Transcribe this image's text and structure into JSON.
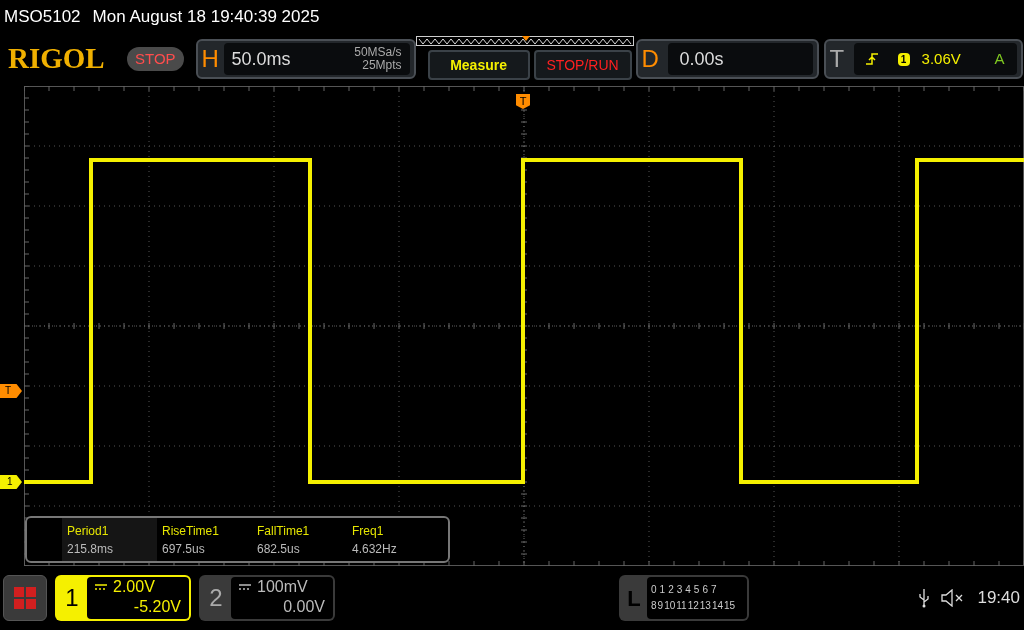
{
  "title_bar": {
    "model": "MSO5102",
    "datetime": "Mon August 18 19:40:39 2025"
  },
  "toolbar": {
    "logo": "RIGOL",
    "run_state": "STOP",
    "horizontal": {
      "label": "H",
      "timebase": "50.0ms",
      "sample_rate": "50MSa/s",
      "memory_depth": "25Mpts"
    },
    "measure_button": "Measure",
    "stop_run_button": "STOP/RUN",
    "delay": {
      "label": "D",
      "value": "0.00s"
    },
    "trigger": {
      "label": "T",
      "source": "1",
      "level": "3.06V",
      "mode": "A"
    }
  },
  "display": {
    "trigger_marker": "T",
    "level_marker": "T",
    "channel_marker": "1"
  },
  "measurements": [
    {
      "name": "Period1",
      "value": "215.8ms",
      "selected": true
    },
    {
      "name": "RiseTime1",
      "value": "697.5us",
      "selected": false
    },
    {
      "name": "FallTime1",
      "value": "682.5us",
      "selected": false
    },
    {
      "name": "Freq1",
      "value": "4.632Hz",
      "selected": false
    }
  ],
  "channels": [
    {
      "number": "1",
      "scale": "2.00V",
      "offset": "-5.20V",
      "selected": true
    },
    {
      "number": "2",
      "scale": "100mV",
      "offset": "0.00V",
      "selected": false
    }
  ],
  "logic": {
    "label": "L",
    "row_1": [
      "0",
      "1",
      "2",
      "3",
      "4",
      "5",
      "6",
      "7"
    ],
    "row_2": [
      "8",
      "9",
      "10",
      "11",
      "12",
      "13",
      "14",
      "15"
    ]
  },
  "status": {
    "muted": true,
    "time": "19:40"
  }
}
